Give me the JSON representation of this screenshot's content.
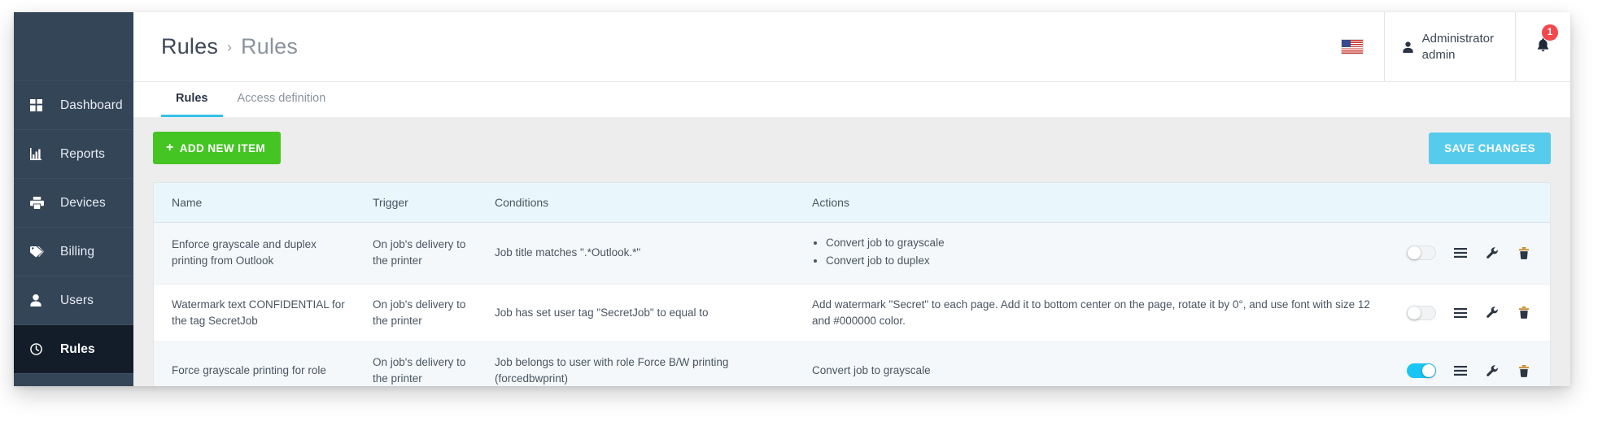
{
  "sidebar": {
    "items": [
      {
        "label": "Dashboard",
        "icon": "dashboard-icon",
        "active": false
      },
      {
        "label": "Reports",
        "icon": "bar-chart-icon",
        "active": false
      },
      {
        "label": "Devices",
        "icon": "printer-icon",
        "active": false
      },
      {
        "label": "Billing",
        "icon": "tag-icon",
        "active": false
      },
      {
        "label": "Users",
        "icon": "user-icon",
        "active": false
      },
      {
        "label": "Rules",
        "icon": "clock-icon",
        "active": true
      }
    ]
  },
  "header": {
    "breadcrumb_parent": "Rules",
    "breadcrumb_separator": "›",
    "breadcrumb_current": "Rules",
    "flag_icon": "us-flag-icon",
    "user_icon": "user-avatar-icon",
    "user_name": "Administrator",
    "user_login": "admin",
    "bell_icon": "bell-icon",
    "notification_count": "1"
  },
  "tabs": [
    {
      "label": "Rules",
      "active": true
    },
    {
      "label": "Access definition",
      "active": false
    }
  ],
  "toolbar": {
    "add_plus": "+",
    "add_label": "ADD NEW ITEM",
    "save_label": "SAVE CHANGES",
    "add_color": "#45c523",
    "save_color": "#57cbeb"
  },
  "table": {
    "columns": [
      "Name",
      "Trigger",
      "Conditions",
      "Actions"
    ],
    "rows": [
      {
        "name": "Enforce grayscale and duplex printing from Outlook",
        "trigger": "On job's delivery to the printer",
        "conditions": "Job title matches \".*Outlook.*\"",
        "actions_list": [
          "Convert job to grayscale",
          "Convert job to duplex"
        ],
        "actions_text": "",
        "enabled": false,
        "controls": [
          "toggle-switch",
          "menu-icon",
          "wrench-icon",
          "trash-icon"
        ]
      },
      {
        "name": "Watermark text CONFIDENTIAL for the tag SecretJob",
        "trigger": "On job's delivery to the printer",
        "conditions": "Job has set user tag \"SecretJob\" to equal to",
        "actions_list": [],
        "actions_text": "Add watermark \"Secret\" to each page. Add it to bottom center on the page, rotate it by 0°, and use font with size 12 and #000000 color.",
        "enabled": false,
        "controls": [
          "toggle-switch",
          "menu-icon",
          "wrench-icon",
          "trash-icon"
        ]
      },
      {
        "name": "Force grayscale printing for role",
        "trigger": "On job's delivery to the printer",
        "conditions": "Job belongs to user with role Force B/W printing (forcedbwprint)",
        "actions_list": [],
        "actions_text": "Convert job to grayscale",
        "enabled": true,
        "controls": [
          "toggle-switch",
          "menu-icon",
          "wrench-icon",
          "trash-icon"
        ]
      }
    ]
  },
  "colors": {
    "sidebar_bg": "#354558",
    "sidebar_active_bg": "#131d29",
    "accent": "#35c1e8",
    "header_row_bg": "#e9f7fd",
    "badge": "#f3474b"
  }
}
